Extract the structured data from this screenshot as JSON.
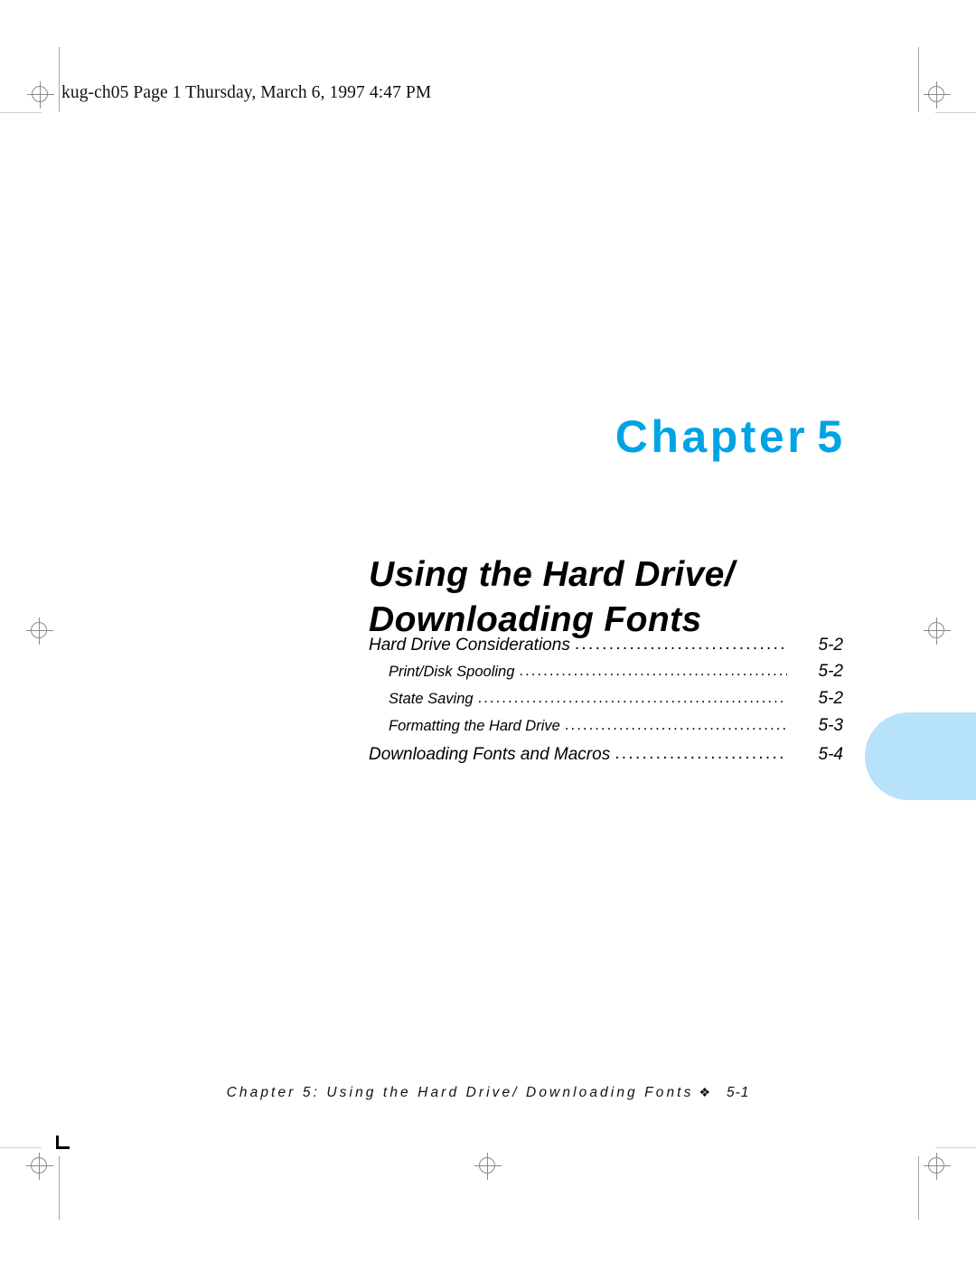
{
  "header": {
    "stamp": "kug-ch05  Page 1  Thursday, March 6, 1997  4:47 PM"
  },
  "chapter": {
    "label": "Chapter",
    "number": "5",
    "accent_color": "#00a3e4",
    "title_line_1": "Using the Hard Drive/",
    "title_line_2": "Downloading Fonts"
  },
  "side_tab": {
    "color": "#b6e2fa"
  },
  "toc": {
    "entries": [
      {
        "label": "Hard Drive Considerations",
        "page": "5-2",
        "level": 1
      },
      {
        "label": "Print/Disk Spooling",
        "page": "5-2",
        "level": 2
      },
      {
        "label": "State Saving",
        "page": "5-2",
        "level": 2
      },
      {
        "label": "Formatting the Hard Drive",
        "page": "5-3",
        "level": 2
      },
      {
        "label": "Downloading Fonts and Macros",
        "page": "5-4",
        "level": 1
      }
    ],
    "leader": "........................................................................................................"
  },
  "footer": {
    "text": "Chapter 5: Using the Hard Drive/ Downloading Fonts",
    "diamond": "❖",
    "page": "5-1"
  }
}
